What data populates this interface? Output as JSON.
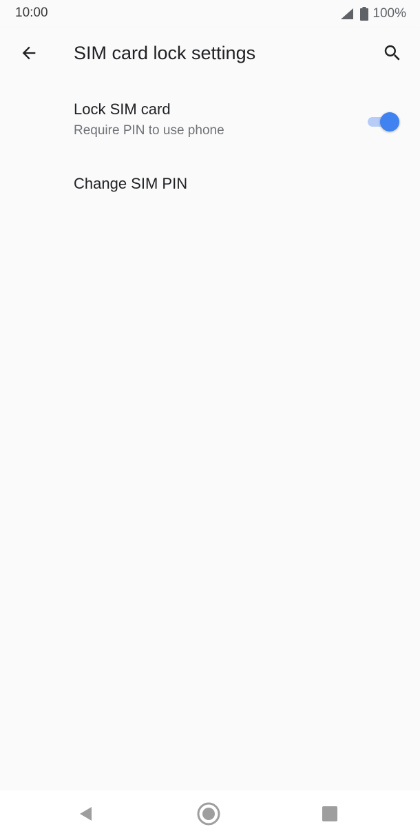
{
  "status_bar": {
    "time": "10:00",
    "battery_percent": "100%",
    "icons": [
      "signal-icon",
      "battery-icon"
    ]
  },
  "app_bar": {
    "title": "SIM card lock settings",
    "back_icon": "arrow-back-icon",
    "search_icon": "search-icon"
  },
  "preferences": {
    "lock_sim": {
      "title": "Lock SIM card",
      "summary": "Require PIN to use phone",
      "toggle_on": true
    },
    "change_pin": {
      "title": "Change SIM PIN"
    }
  },
  "nav_bar": {
    "icons": [
      "nav-back-icon",
      "nav-home-icon",
      "nav-recents-icon"
    ]
  },
  "colors": {
    "accent": "#3f82f0",
    "accent_track": "#b7cdf7",
    "background": "#fafafa"
  }
}
